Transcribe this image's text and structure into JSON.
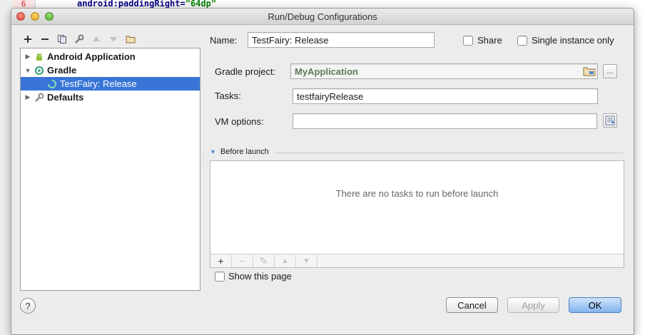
{
  "editor": {
    "line_number": "6",
    "code_attr": "android:paddingRight=",
    "code_value": "\"64dp\""
  },
  "window": {
    "title": "Run/Debug Configurations"
  },
  "left_toolbar": {
    "icons": [
      "add-icon",
      "remove-icon",
      "copy-icon",
      "wrench-icon",
      "move-up-icon",
      "move-down-icon",
      "folder-icon"
    ]
  },
  "tree": {
    "items": [
      {
        "label": "Android Application",
        "icon": "android-icon"
      },
      {
        "label": "Gradle",
        "icon": "gradle-icon"
      },
      {
        "label": "TestFairy: Release",
        "icon": "gradle-task-icon",
        "selected": true
      },
      {
        "label": "Defaults",
        "icon": "wrench-icon"
      }
    ]
  },
  "config": {
    "name_label": "Name:",
    "name_value": "TestFairy: Release",
    "share_label": "Share",
    "single_instance_label": "Single instance only",
    "gradle_project_label": "Gradle project:",
    "gradle_project_value": "MyApplication",
    "browse_ellipsis": "...",
    "tasks_label": "Tasks:",
    "tasks_value": "testfairyRelease",
    "vm_options_label": "VM options:",
    "vm_options_value": ""
  },
  "before_launch": {
    "title": "Before launch",
    "empty_text": "There are no tasks to run before launch",
    "toolbar": [
      "+",
      "−",
      "✎",
      "▲",
      "▼"
    ]
  },
  "show_page_label": "Show this page",
  "buttons": {
    "help": "?",
    "cancel": "Cancel",
    "apply": "Apply",
    "ok": "OK"
  },
  "colors": {
    "selection": "#3875d7",
    "ok_button": "#82b3ee"
  }
}
